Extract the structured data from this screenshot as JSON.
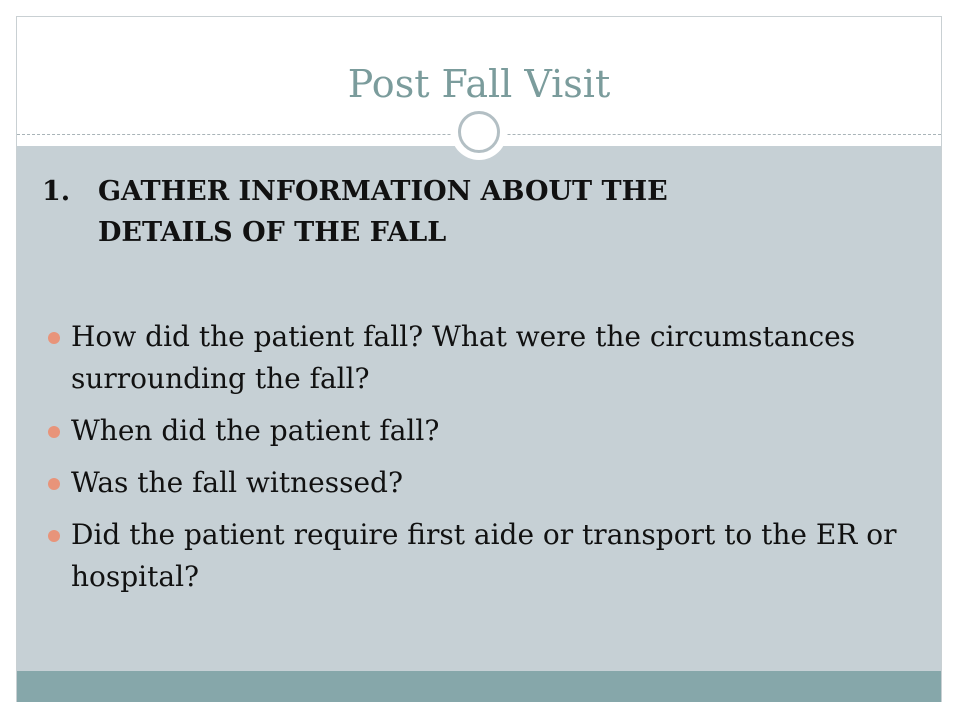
{
  "slide": {
    "title": "Post Fall Visit",
    "heading": {
      "number": "1.",
      "line1": "GATHER INFORMATION ABOUT THE",
      "line2": "DETAILS OF THE FALL"
    },
    "bullets": [
      {
        "text": "How did the patient fall?  What were the circumstances surrounding the fall?"
      },
      {
        "text": "When did the patient fall?"
      },
      {
        "text": "Was the fall witnessed?"
      },
      {
        "text": "Did the patient require first aide or transport to the ER or hospital?"
      }
    ]
  },
  "colors": {
    "title": "#7b9c9c",
    "content_background": "#c6d0d5",
    "bottom_bar": "#86a7aa",
    "bullet": "#e8947a"
  }
}
